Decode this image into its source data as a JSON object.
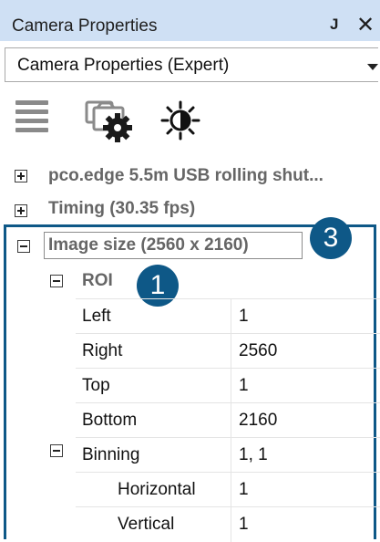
{
  "window": {
    "title": "Camera Properties",
    "pin_glyph": "Ȩ",
    "close_glyph": "✕"
  },
  "dropdown": {
    "selected": "Camera Properties (Expert)"
  },
  "toolbar": {
    "icons": [
      "menu-icon",
      "camera-settings-icon",
      "brightness-icon"
    ]
  },
  "tree": {
    "camera": "pco.edge 5.5m USB rolling shut...",
    "timing": "Timing (30.35 fps)",
    "image_size": "Image size (2560 x 2160)",
    "roi": "ROI"
  },
  "properties": {
    "left": {
      "name": "Left",
      "value": "1"
    },
    "right": {
      "name": "Right",
      "value": "2560"
    },
    "top": {
      "name": "Top",
      "value": "1"
    },
    "bottom": {
      "name": "Bottom",
      "value": "2160"
    },
    "binning": {
      "name": "Binning",
      "value": "1, 1"
    },
    "horizontal": {
      "name": "Horizontal",
      "value": "1"
    },
    "vertical": {
      "name": "Vertical",
      "value": "1"
    }
  },
  "annotations": {
    "badge_3": "3",
    "badge_1": "1"
  },
  "colors": {
    "titlebar": "#cfe0f4",
    "annotation_blue": "#0e5887",
    "category_text": "#666666"
  }
}
